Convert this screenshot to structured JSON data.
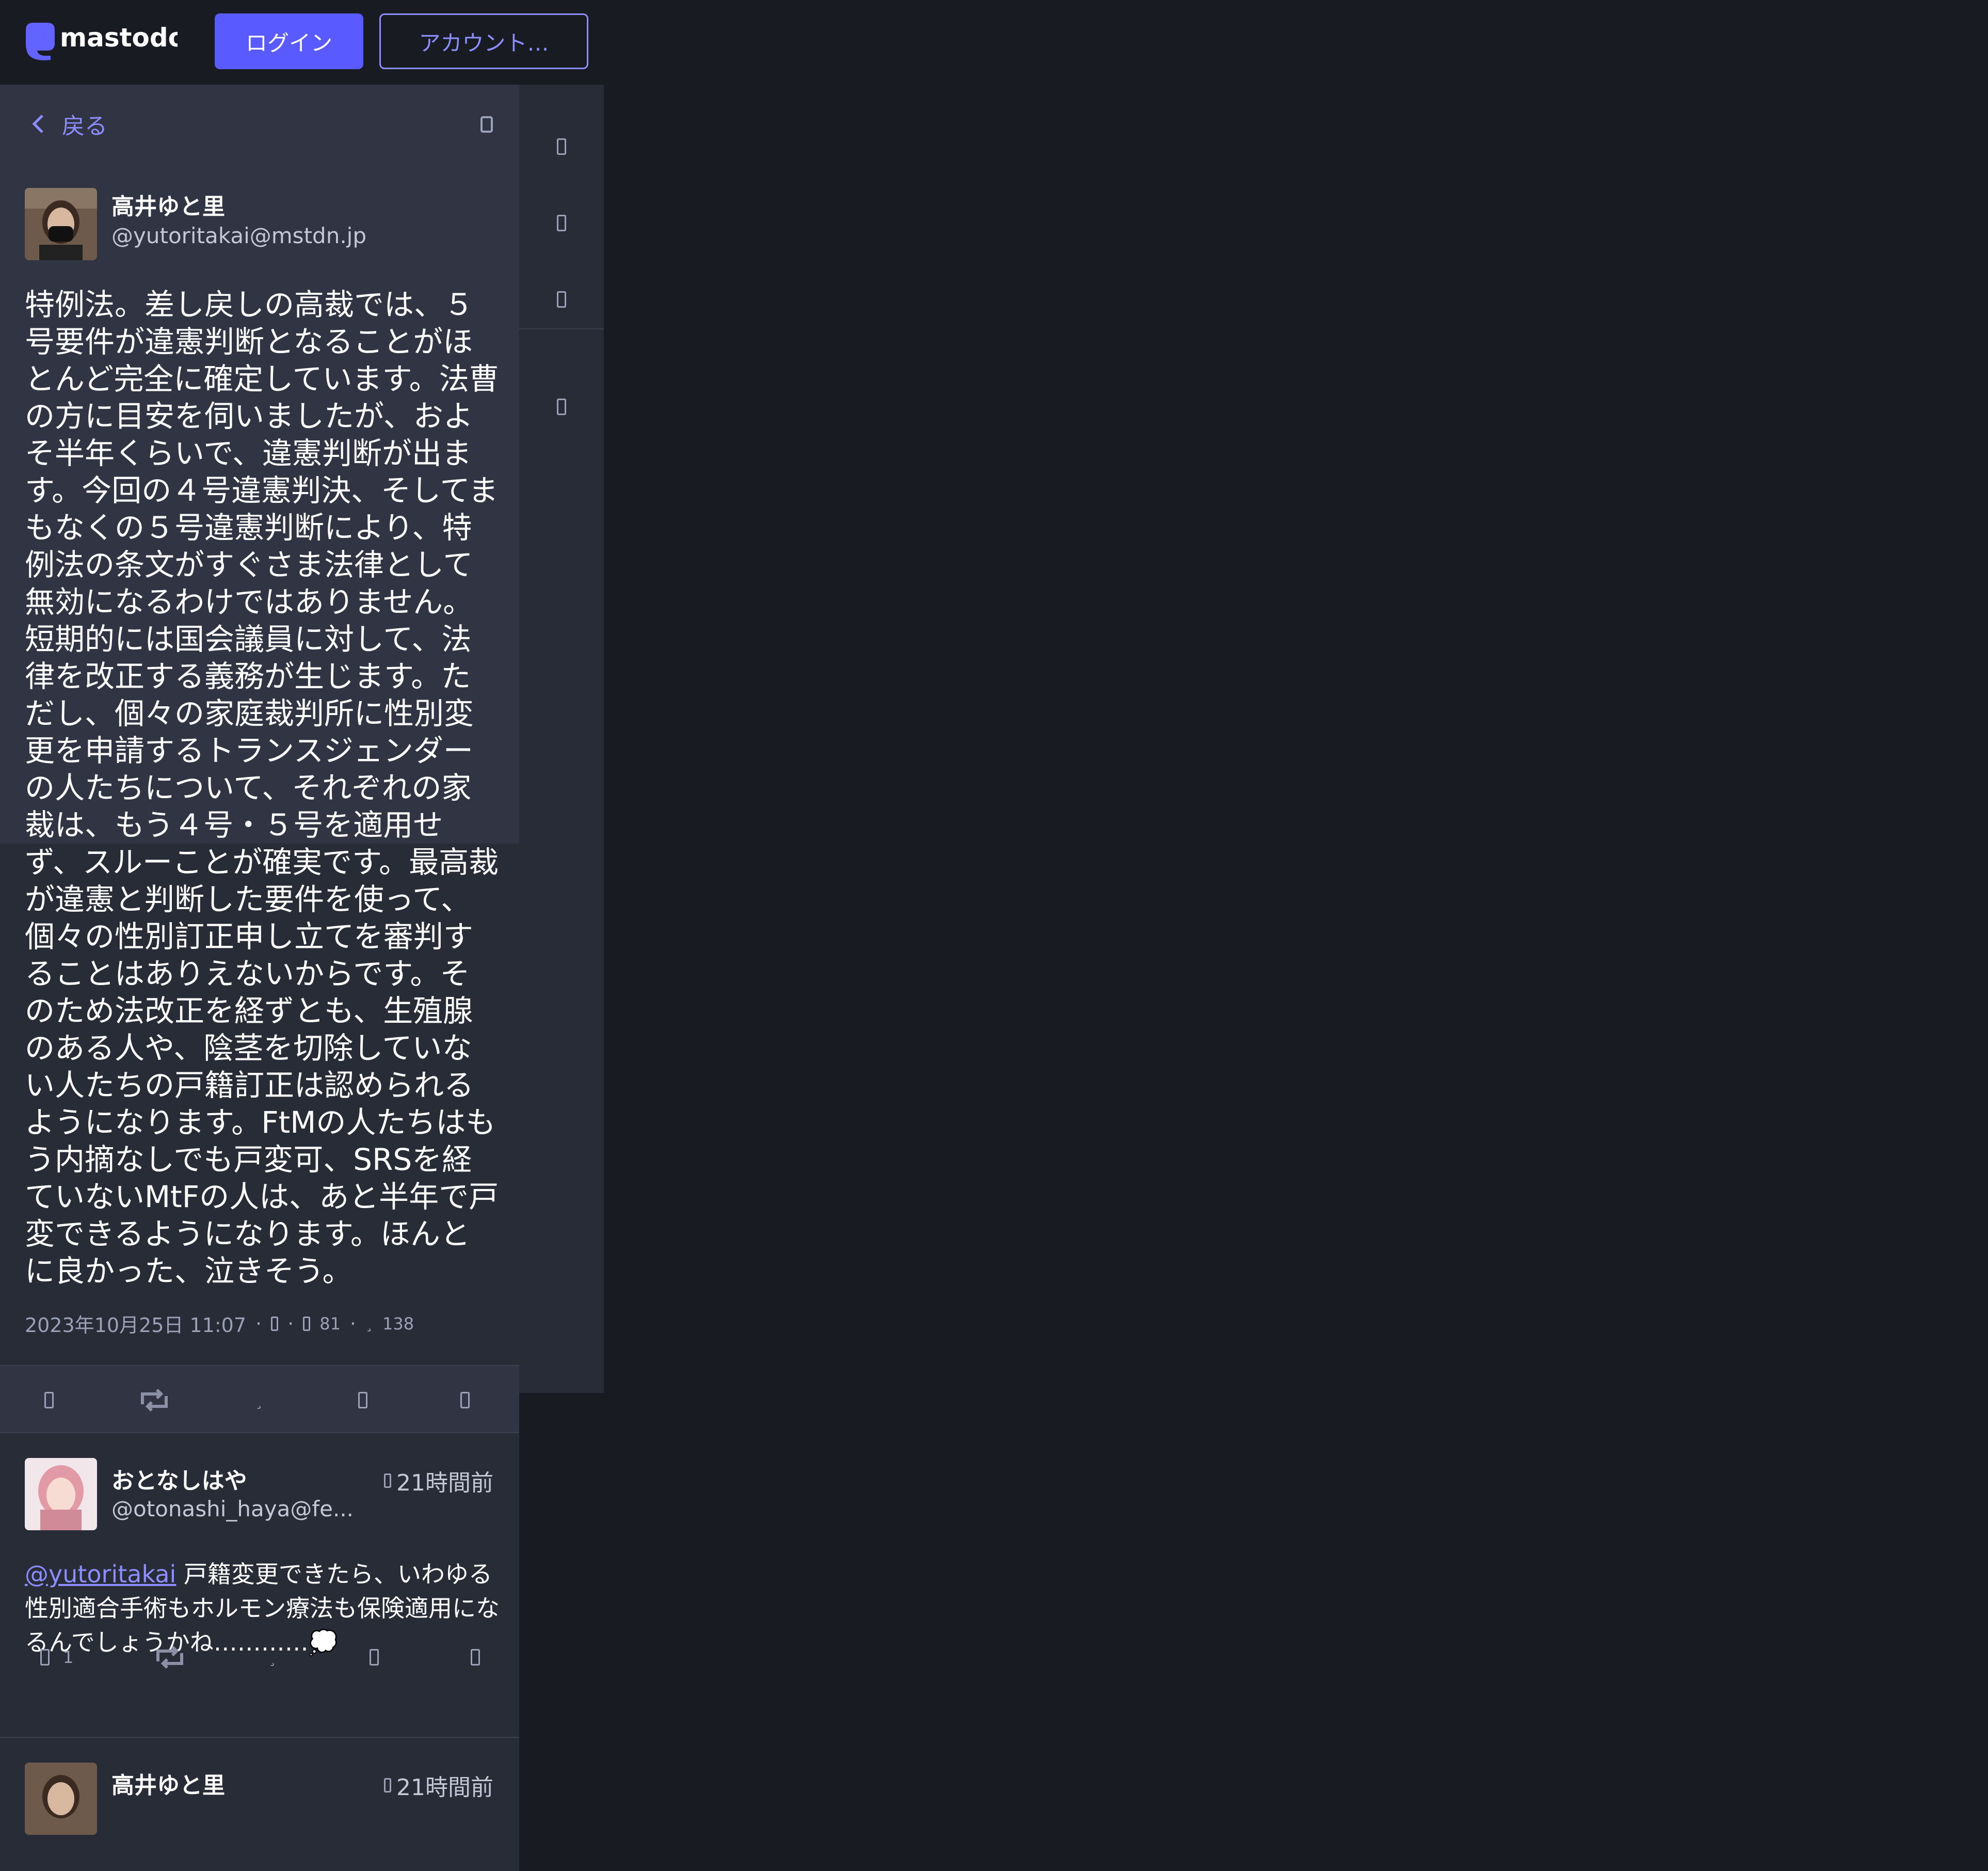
{
  "brand": {
    "name": "mastodon",
    "accent": "#595aff"
  },
  "header": {
    "login_label": "ログイン",
    "account_label": "アカウント…"
  },
  "column_header": {
    "back_label": "戻る"
  },
  "main_status": {
    "display_name": "高井ゆと里",
    "acct": "@yutoritakai@mstdn.jp",
    "content": "特例法。差し戻しの高裁では、５号要件が違憲判断となることがほとんど完全に確定しています。法曹の方に目安を伺いましたが、およそ半年くらいで、違憲判断が出ます。今回の４号違憲判決、そしてまもなくの５号違憲判断により、特例法の条文がすぐさま法律として無効になるわけではありません。短期的には国会議員に対して、法律を改正する義務が生じます。ただし、個々の家庭裁判所に性別変更を申請するトランスジェンダーの人たちについて、それぞれの家裁は、もう４号・５号を適用せず、スルーことが確実です。最高裁が違憲と判断した要件を使って、個々の性別訂正申し立てを審判することはありえないからです。そのため法改正を経ずとも、生殖腺のある人や、陰茎を切除していない人たちの戸籍訂正は認められるようになります。FtMの人たちはもう内摘なしでも戸変可、SRSを経ていないMtFの人は、あと半年で戸変できるようになります。ほんとに良かった、泣きそう。",
    "timestamp": "2023年10月25日 11:07",
    "sep": "·",
    "boosts_count": "81",
    "favourites_count": "138"
  },
  "replies": [
    {
      "display_name": "おとなしはや",
      "acct": "@otonashi_haya@fe...",
      "time": "21時間前",
      "mention": "@yutoritakai",
      "content": " 戸籍変更できたら、いわゆる性別適合手術もホルモン療法も保険適用になるんでしょうかね…………💭",
      "reply_count": "1"
    },
    {
      "display_name": "高井ゆと里",
      "time": "21時間前"
    }
  ]
}
